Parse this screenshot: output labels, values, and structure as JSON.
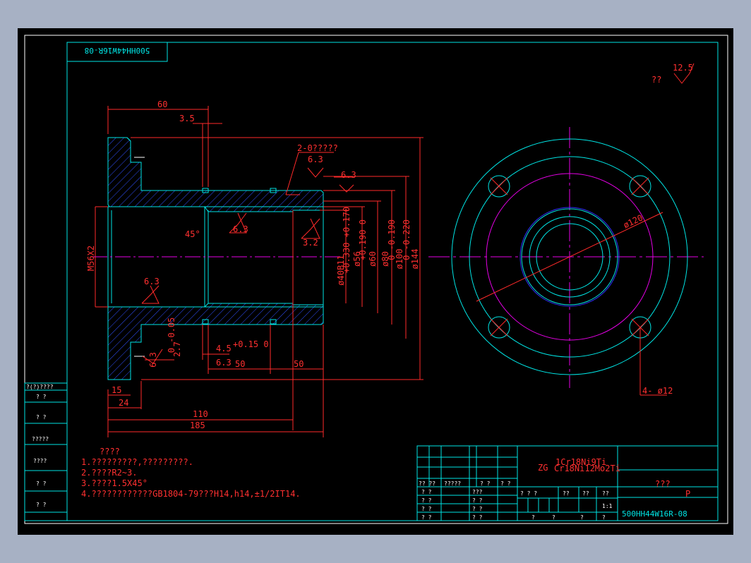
{
  "title_mirrored": "500HH44W16R-08",
  "roughness": {
    "global_prefix": "??",
    "global_value": "12.5",
    "hole_values": [
      "6.3",
      "6.3",
      "3.2",
      "6.3",
      "6.3",
      "6.3",
      "6.3"
    ]
  },
  "dims": {
    "d60": "60",
    "d35": "3.5",
    "holes_label": "2-0?????",
    "m56": "M56X2",
    "a45": "45°",
    "phi40": "ø40B11",
    "phi40_tol": "+0.330 +0.170",
    "phi56": "ø56",
    "phi56_tol": "+0.190 0",
    "phi60": "ø60",
    "phi80": "ø80",
    "phi80_tol": "0 -0.190",
    "phi100": "ø100",
    "phi100_tol": "0 -0.220",
    "phi144": "ø144",
    "d27": "2.7",
    "d27_tol": "0 -0.05",
    "d45": "4.5",
    "d45_tol": "+0.15 0",
    "d50a": "50",
    "d50b": "50",
    "d15": "15",
    "d24": "24",
    "d110": "110",
    "d185": "185",
    "phi120": "ø120",
    "phi12": "4- ø12"
  },
  "notes": {
    "heading": "????",
    "lines": [
      "1.?????????,?????????.",
      "2.????R2~3.",
      "3.????1.5X45°",
      "4.????????????GB1804-79???H14,h14,±1/2IT14."
    ]
  },
  "left_strip": [
    "?(?)????",
    "?  ?",
    "?  ?",
    "?????",
    "????",
    "?  ?",
    "?  ?"
  ],
  "title_block": {
    "material_prefix": "ZG",
    "material_line1": "1Cr18Ni9Ti",
    "material_line2": "Cr18Ni12Mo2Ti",
    "name": "???",
    "drawing_no": "500HH44W16R-08",
    "code": "P",
    "scale": "1:1",
    "header_row": [
      "?? ??",
      "?????",
      "?  ?",
      "?  ?"
    ],
    "left_rows": [
      "?  ?",
      "?  ?",
      "?  ?",
      "?  ?"
    ],
    "mid_rows": [
      "???",
      "?  ?",
      "?  ?",
      "?  ?"
    ],
    "info_header": [
      "?  ?  ?",
      "??",
      "??",
      "??"
    ],
    "bottom_row": [
      "?",
      "?",
      "?",
      "?"
    ]
  }
}
